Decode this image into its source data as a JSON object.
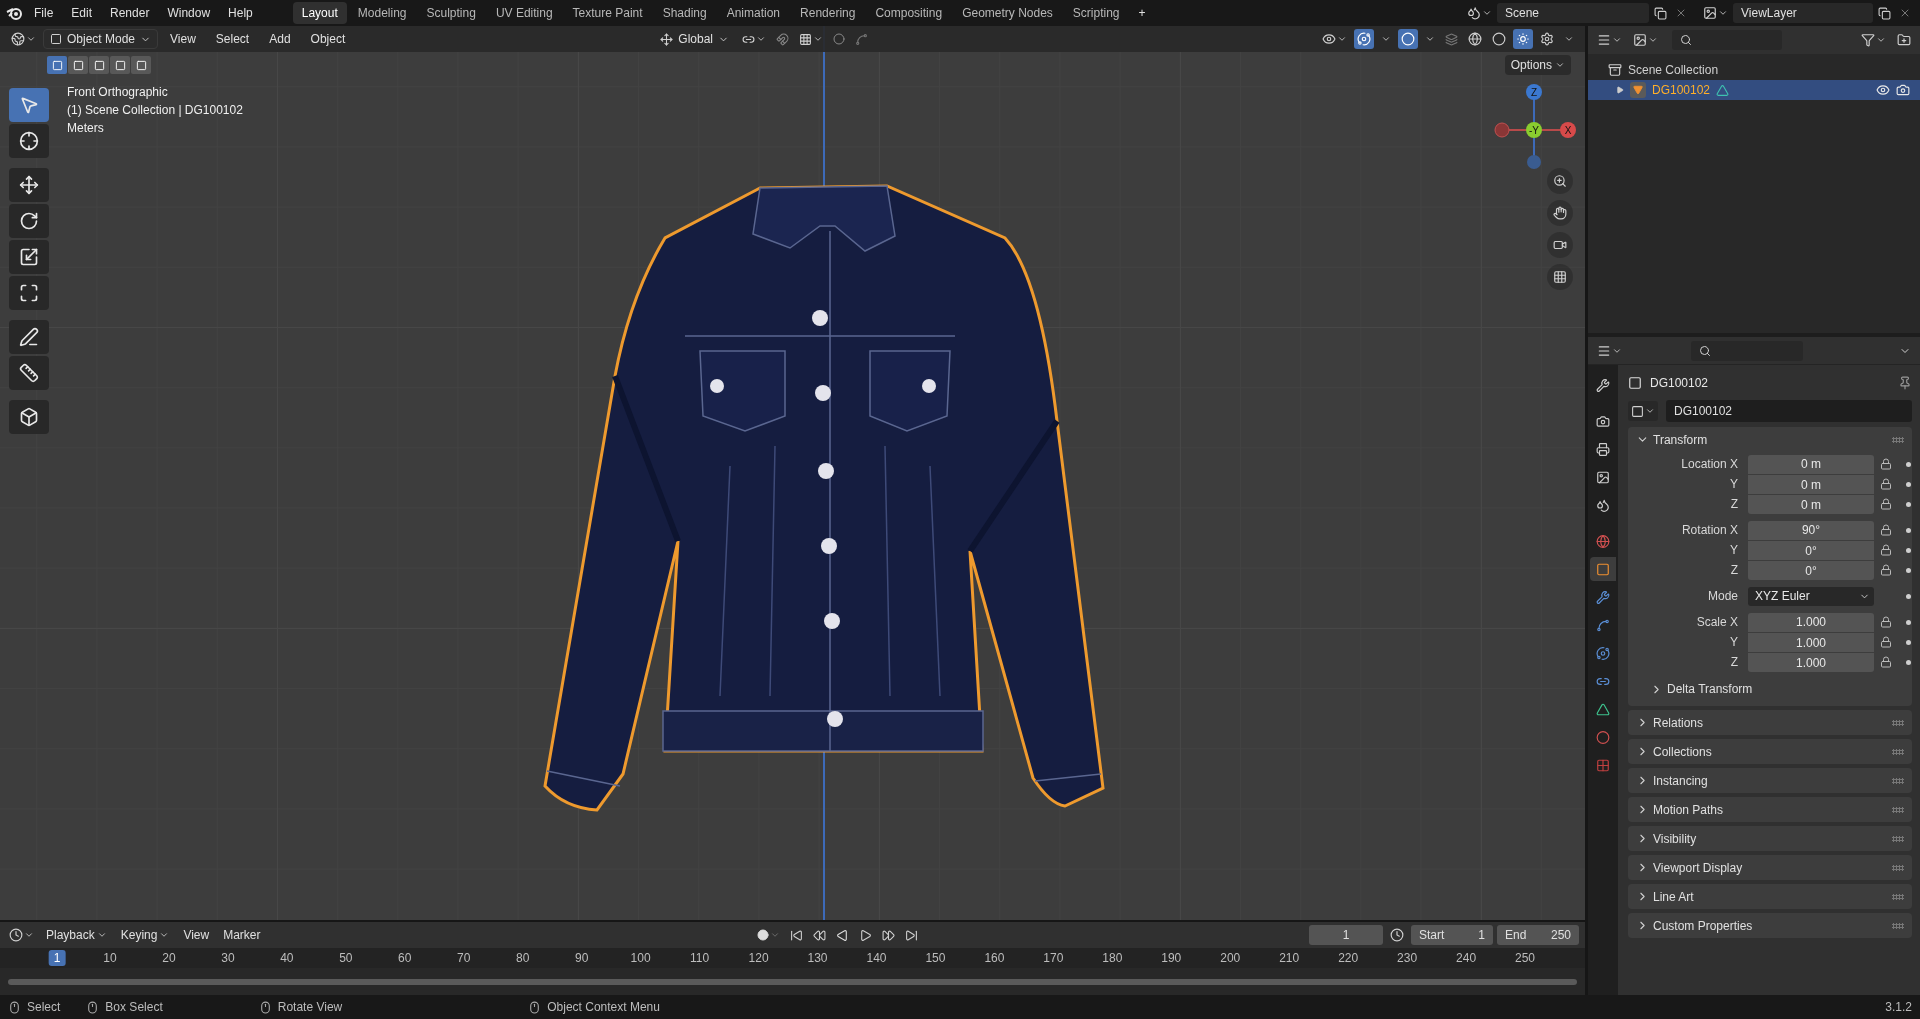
{
  "menu": [
    "File",
    "Edit",
    "Render",
    "Window",
    "Help"
  ],
  "workspaces": [
    {
      "label": "Layout",
      "selected": true
    },
    {
      "label": "Modeling",
      "selected": false
    },
    {
      "label": "Sculpting",
      "selected": false
    },
    {
      "label": "UV Editing",
      "selected": false
    },
    {
      "label": "Texture Paint",
      "selected": false
    },
    {
      "label": "Shading",
      "selected": false
    },
    {
      "label": "Animation",
      "selected": false
    },
    {
      "label": "Rendering",
      "selected": false
    },
    {
      "label": "Compositing",
      "selected": false
    },
    {
      "label": "Geometry Nodes",
      "selected": false
    },
    {
      "label": "Scripting",
      "selected": false
    }
  ],
  "add_workspace": "+",
  "scene": "Scene",
  "view_layer": "ViewLayer",
  "viewport": {
    "mode": "Object Mode",
    "menus": [
      "View",
      "Select",
      "Add",
      "Object"
    ],
    "orientation": "Global",
    "options": "Options",
    "select_modes": [
      {
        "selected": true
      },
      {
        "selected": false
      },
      {
        "selected": false
      },
      {
        "selected": false
      },
      {
        "selected": false
      }
    ],
    "info": [
      "Front Orthographic",
      "(1) Scene Collection | DG100102",
      "Meters"
    ],
    "gizmo": {
      "z": "Z",
      "y": "-Y",
      "x": "X"
    },
    "tools": [
      {
        "selected": true
      },
      {
        "selected": false
      },
      {
        "selected": false
      },
      {
        "selected": false
      },
      {
        "selected": false
      },
      {
        "selected": false
      },
      {
        "selected": false
      },
      {
        "selected": false
      },
      {
        "selected": false
      }
    ],
    "shading": [
      {
        "selected": false
      },
      {
        "selected": false
      },
      {
        "selected": true
      },
      {
        "selected": false
      }
    ],
    "content": {
      "kind": "picture"
    }
  },
  "outliner": {
    "root": "Scene Collection",
    "items": [
      {
        "name": "DG100102",
        "selected": true,
        "visible": true
      }
    ]
  },
  "properties": {
    "object": "DG100102",
    "data_name": "DG100102",
    "tabs": [
      {
        "selected": false
      },
      {
        "selected": false
      },
      {
        "selected": false
      },
      {
        "selected": false
      },
      {
        "selected": false
      },
      {
        "selected": false
      },
      {
        "selected": true
      },
      {
        "selected": false
      },
      {
        "selected": false
      },
      {
        "selected": false
      },
      {
        "selected": false
      },
      {
        "selected": false
      },
      {
        "selected": false
      },
      {
        "selected": false
      }
    ],
    "transform": {
      "title": "Transform",
      "expanded": true,
      "groups": [
        {
          "rows": [
            {
              "label": "Location X",
              "value": "0 m",
              "kind": "number"
            },
            {
              "label": "Y",
              "value": "0 m",
              "kind": "number"
            },
            {
              "label": "Z",
              "value": "0 m",
              "kind": "number"
            }
          ]
        },
        {
          "rows": [
            {
              "label": "Rotation X",
              "value": "90°",
              "kind": "number"
            },
            {
              "label": "Y",
              "value": "0°",
              "kind": "number"
            },
            {
              "label": "Z",
              "value": "0°",
              "kind": "number"
            }
          ]
        },
        {
          "rows": [
            {
              "label": "Mode",
              "value": "XYZ Euler",
              "kind": "dropdown"
            }
          ]
        },
        {
          "rows": [
            {
              "label": "Scale X",
              "value": "1.000",
              "kind": "number"
            },
            {
              "label": "Y",
              "value": "1.000",
              "kind": "number"
            },
            {
              "label": "Z",
              "value": "1.000",
              "kind": "number"
            }
          ]
        }
      ],
      "subpanel": {
        "title": "Delta Transform",
        "expanded": false
      }
    },
    "panels": [
      {
        "title": "Relations",
        "expanded": false
      },
      {
        "title": "Collections",
        "expanded": false
      },
      {
        "title": "Instancing",
        "expanded": false
      },
      {
        "title": "Motion Paths",
        "expanded": false
      },
      {
        "title": "Visibility",
        "expanded": false
      },
      {
        "title": "Viewport Display",
        "expanded": false
      },
      {
        "title": "Line Art",
        "expanded": false
      },
      {
        "title": "Custom Properties",
        "expanded": false
      }
    ]
  },
  "timeline": {
    "menus": [
      {
        "label": "Playback",
        "dropdown": true
      },
      {
        "label": "Keying",
        "dropdown": true
      },
      {
        "label": "View",
        "dropdown": false
      },
      {
        "label": "Marker",
        "dropdown": false
      }
    ],
    "current_frame": "1",
    "start_label": "Start",
    "start": "1",
    "end_label": "End",
    "end": "250",
    "ruler": [
      {
        "label": "1",
        "selected": true
      },
      {
        "label": "10",
        "selected": false
      },
      {
        "label": "20",
        "selected": false
      },
      {
        "label": "30",
        "selected": false
      },
      {
        "label": "40",
        "selected": false
      },
      {
        "label": "50",
        "selected": false
      },
      {
        "label": "60",
        "selected": false
      },
      {
        "label": "70",
        "selected": false
      },
      {
        "label": "80",
        "selected": false
      },
      {
        "label": "90",
        "selected": false
      },
      {
        "label": "100",
        "selected": false
      },
      {
        "label": "110",
        "selected": false
      },
      {
        "label": "120",
        "selected": false
      },
      {
        "label": "130",
        "selected": false
      },
      {
        "label": "140",
        "selected": false
      },
      {
        "label": "150",
        "selected": false
      },
      {
        "label": "160",
        "selected": false
      },
      {
        "label": "170",
        "selected": false
      },
      {
        "label": "180",
        "selected": false
      },
      {
        "label": "190",
        "selected": false
      },
      {
        "label": "200",
        "selected": false
      },
      {
        "label": "210",
        "selected": false
      },
      {
        "label": "220",
        "selected": false
      },
      {
        "label": "230",
        "selected": false
      },
      {
        "label": "240",
        "selected": false
      },
      {
        "label": "250",
        "selected": false
      }
    ]
  },
  "status": {
    "hints": [
      "Select",
      "Box Select",
      "Rotate View",
      "Object Context Menu"
    ],
    "version": "3.1.2"
  }
}
